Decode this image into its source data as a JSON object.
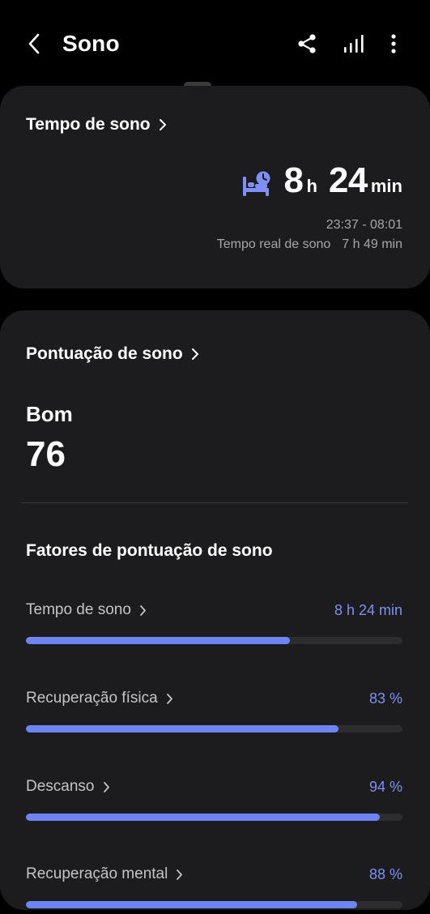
{
  "header": {
    "title": "Sono",
    "back_icon": "chevron-left-icon",
    "share_icon": "share-icon",
    "stats_icon": "signal-bars-icon",
    "more_icon": "more-vertical-icon"
  },
  "sleep_time_card": {
    "title": "Tempo de sono",
    "hours": "8",
    "hours_unit": "h",
    "minutes": "24",
    "minutes_unit": "min",
    "time_range": "23:37 - 08:01",
    "real_sleep_label": "Tempo real de sono",
    "real_sleep_value": "7 h 49 min",
    "icon": "bed-clock-icon"
  },
  "score_card": {
    "title": "Pontuação de sono",
    "rating": "Bom",
    "score": "76",
    "factors_title": "Fatores de pontuação de sono",
    "factors": [
      {
        "name": "Tempo de sono",
        "value": "8 h 24 min",
        "level": 0.7
      },
      {
        "name": "Recuperação física",
        "value": "83 %",
        "level": 0.83
      },
      {
        "name": "Descanso",
        "value": "94 %",
        "level": 0.94
      },
      {
        "name": "Recuperação mental",
        "value": "88 %",
        "level": 0.88
      }
    ]
  },
  "colors": {
    "background": "#000000",
    "card": "#1c1c1e",
    "accent": "#6f84f3",
    "accent_text": "#7e8ff5",
    "secondary_text": "#a7a7ab"
  }
}
